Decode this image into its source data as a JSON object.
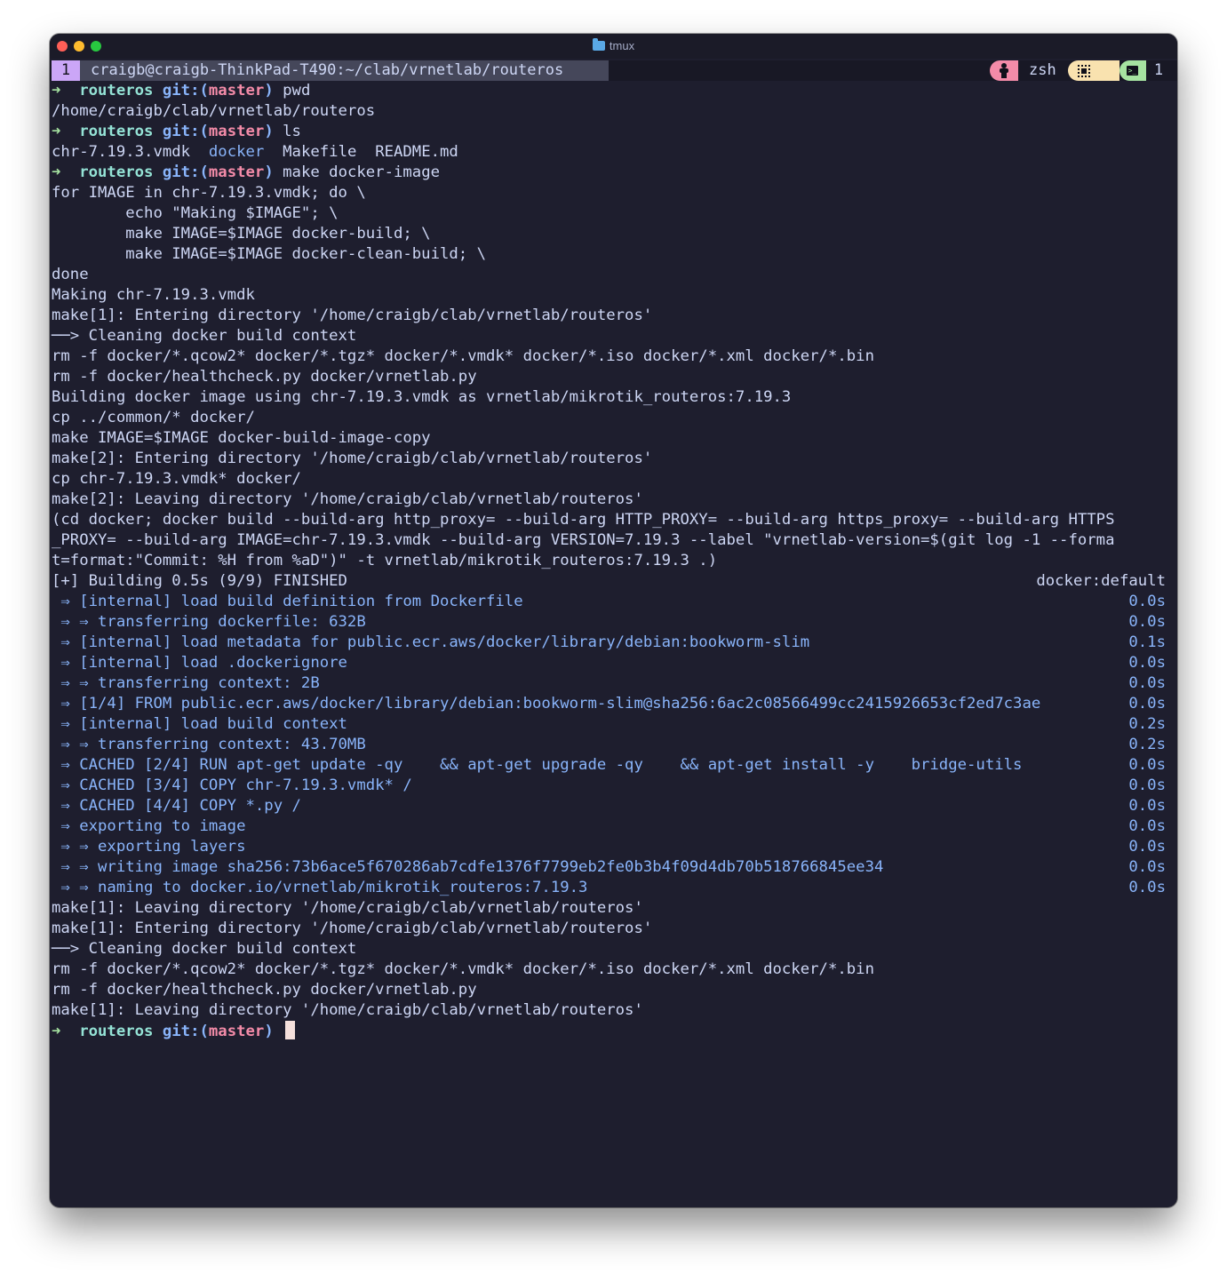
{
  "window": {
    "title": "tmux"
  },
  "status": {
    "window_index": "1",
    "window_title": "craigb@craigb-ThinkPad-T490:~/clab/vrnetlab/routeros",
    "session_name": "zsh",
    "window_count": "1",
    "icons": [
      "person-icon",
      "cpu-icon",
      "terminal-icon"
    ]
  },
  "prompt": {
    "arrow": "➜",
    "dir": "routeros",
    "git_label": "git:(",
    "branch": "master",
    "git_close": ")"
  },
  "lines": {
    "cmd1": "pwd",
    "out1": "/home/craigb/clab/vrnetlab/routeros",
    "cmd2": "ls",
    "ls_file1": "chr-7.19.3.vmdk",
    "ls_dir": "docker",
    "ls_file2": "Makefile",
    "ls_file3": "README.md",
    "cmd3": "make docker-image",
    "l01": "for IMAGE in chr-7.19.3.vmdk; do \\",
    "l02": "        echo \"Making $IMAGE\"; \\",
    "l03": "        make IMAGE=$IMAGE docker-build; \\",
    "l04": "        make IMAGE=$IMAGE docker-clean-build; \\",
    "l05": "done",
    "l06": "Making chr-7.19.3.vmdk",
    "l07": "make[1]: Entering directory '/home/craigb/clab/vrnetlab/routeros'",
    "l08": "──> Cleaning docker build context",
    "l09": "rm -f docker/*.qcow2* docker/*.tgz* docker/*.vmdk* docker/*.iso docker/*.xml docker/*.bin",
    "l10": "rm -f docker/healthcheck.py docker/vrnetlab.py",
    "l11": "Building docker image using chr-7.19.3.vmdk as vrnetlab/mikrotik_routeros:7.19.3",
    "l12": "cp ../common/* docker/",
    "l13": "make IMAGE=$IMAGE docker-build-image-copy",
    "l14": "make[2]: Entering directory '/home/craigb/clab/vrnetlab/routeros'",
    "l15": "cp chr-7.19.3.vmdk* docker/",
    "l16": "make[2]: Leaving directory '/home/craigb/clab/vrnetlab/routeros'",
    "l17": "(cd docker; docker build --build-arg http_proxy= --build-arg HTTP_PROXY= --build-arg https_proxy= --build-arg HTTPS",
    "l18": "_PROXY= --build-arg IMAGE=chr-7.19.3.vmdk --build-arg VERSION=7.19.3 --label \"vrnetlab-version=$(git log -1 --forma",
    "l19": "t=format:\"Commit: %H from %aD\")\" -t vrnetlab/mikrotik_routeros:7.19.3 .)",
    "build_header": "[+] Building 0.5s (9/9) FINISHED",
    "build_context": "docker:default",
    "after01": "make[1]: Leaving directory '/home/craigb/clab/vrnetlab/routeros'",
    "after02": "make[1]: Entering directory '/home/craigb/clab/vrnetlab/routeros'",
    "after03": "──> Cleaning docker build context",
    "after04": "rm -f docker/*.qcow2* docker/*.tgz* docker/*.vmdk* docker/*.iso docker/*.xml docker/*.bin",
    "after05": "rm -f docker/healthcheck.py docker/vrnetlab.py",
    "after06": "make[1]: Leaving directory '/home/craigb/clab/vrnetlab/routeros'"
  },
  "build_steps": [
    {
      "text": " ⇒ [internal] load build definition from Dockerfile",
      "time": "0.0s"
    },
    {
      "text": " ⇒ ⇒ transferring dockerfile: 632B",
      "time": "0.0s"
    },
    {
      "text": " ⇒ [internal] load metadata for public.ecr.aws/docker/library/debian:bookworm-slim",
      "time": "0.1s"
    },
    {
      "text": " ⇒ [internal] load .dockerignore",
      "time": "0.0s"
    },
    {
      "text": " ⇒ ⇒ transferring context: 2B",
      "time": "0.0s"
    },
    {
      "text": " ⇒ [1/4] FROM public.ecr.aws/docker/library/debian:bookworm-slim@sha256:6ac2c08566499cc2415926653cf2ed7c3ae",
      "time": "0.0s"
    },
    {
      "text": " ⇒ [internal] load build context",
      "time": "0.2s"
    },
    {
      "text": " ⇒ ⇒ transferring context: 43.70MB",
      "time": "0.2s"
    },
    {
      "text": " ⇒ CACHED [2/4] RUN apt-get update -qy    && apt-get upgrade -qy    && apt-get install -y    bridge-utils",
      "time": "0.0s"
    },
    {
      "text": " ⇒ CACHED [3/4] COPY chr-7.19.3.vmdk* /",
      "time": "0.0s"
    },
    {
      "text": " ⇒ CACHED [4/4] COPY *.py /",
      "time": "0.0s"
    },
    {
      "text": " ⇒ exporting to image",
      "time": "0.0s"
    },
    {
      "text": " ⇒ ⇒ exporting layers",
      "time": "0.0s"
    },
    {
      "text": " ⇒ ⇒ writing image sha256:73b6ace5f670286ab7cdfe1376f7799eb2fe0b3b4f09d4db70b518766845ee34",
      "time": "0.0s"
    },
    {
      "text": " ⇒ ⇒ naming to docker.io/vrnetlab/mikrotik_routeros:7.19.3",
      "time": "0.0s"
    }
  ],
  "colors": {
    "background": "#1e1e2e",
    "foreground": "#cdd6f4",
    "prompt_arrow": "#a6e3a1",
    "prompt_dir": "#94e2d5",
    "git": "#89b4fa",
    "branch": "#f38ba8",
    "build_step": "#89b4fa"
  }
}
